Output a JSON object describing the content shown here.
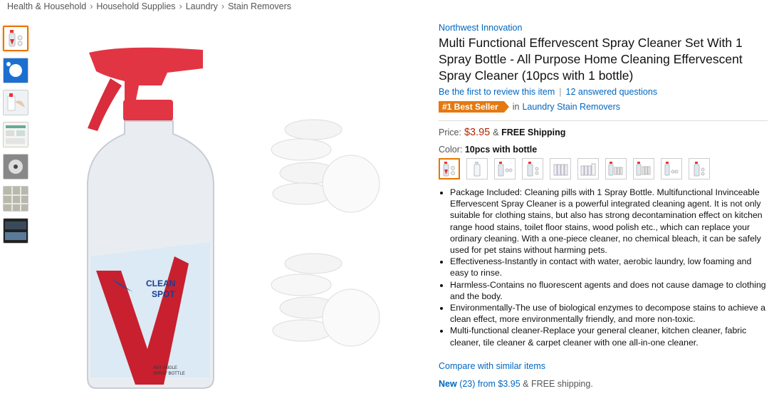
{
  "breadcrumb": [
    "Health & Household",
    "Household Supplies",
    "Laundry",
    "Stain Removers"
  ],
  "product": {
    "brand": "Northwest Innovation",
    "title": "Multi Functional Effervescent Spray Cleaner Set With 1 Spray Bottle - All Purpose Home Cleaning Effervescent Spray Cleaner (10pcs with 1 bottle)",
    "review_link": "Be the first to review this item",
    "questions_link": "12 answered questions",
    "best_seller_badge": "#1 Best Seller",
    "best_seller_in": "in",
    "best_seller_category": "Laundry Stain Removers",
    "price_label": "Price:",
    "price": "$3.95",
    "price_amp": "&",
    "shipping": "FREE Shipping",
    "color_label": "Color:",
    "color_value": "10pcs with bottle",
    "bottle_text": "CLEAN SPOT",
    "bottle_subtext": "ANY ANGLE SPRAY BOTTLE",
    "bullets": [
      "Package Included: Cleaning pills with 1 Spray Bottle. Multifunctional Invinceable Effervescent Spray Cleaner is a powerful integrated cleaning agent. It is not only suitable for clothing stains, but also has strong decontamination effect on kitchen range hood stains, toilet floor stains, wood polish etc., which can replace your ordinary cleaning. With a one-piece cleaner, no chemical bleach, it can be safely used for pet stains without harming pets.",
      "Effectiveness-Instantly in contact with water, aerobic laundry, low foaming and easy to rinse.",
      "Harmless-Contains no fluorescent agents and does not cause damage to clothing and the body.",
      "Environmentally-The use of biological enzymes to decompose stains to achieve a clean effect, more environmentally friendly, and more non-toxic.",
      "Multi-functional cleaner-Replace your general cleaner, kitchen cleaner, fabric cleaner, tile cleaner & carpet cleaner with one all-in-one cleaner."
    ],
    "compare_link": "Compare with similar items",
    "new_label": "New",
    "new_count": "(23) from $3.95",
    "new_shipping": "& FREE shipping."
  },
  "colors": {
    "link": "#0066c0",
    "price": "#b12704",
    "badge": "#e47911",
    "selected": "#e77600"
  }
}
